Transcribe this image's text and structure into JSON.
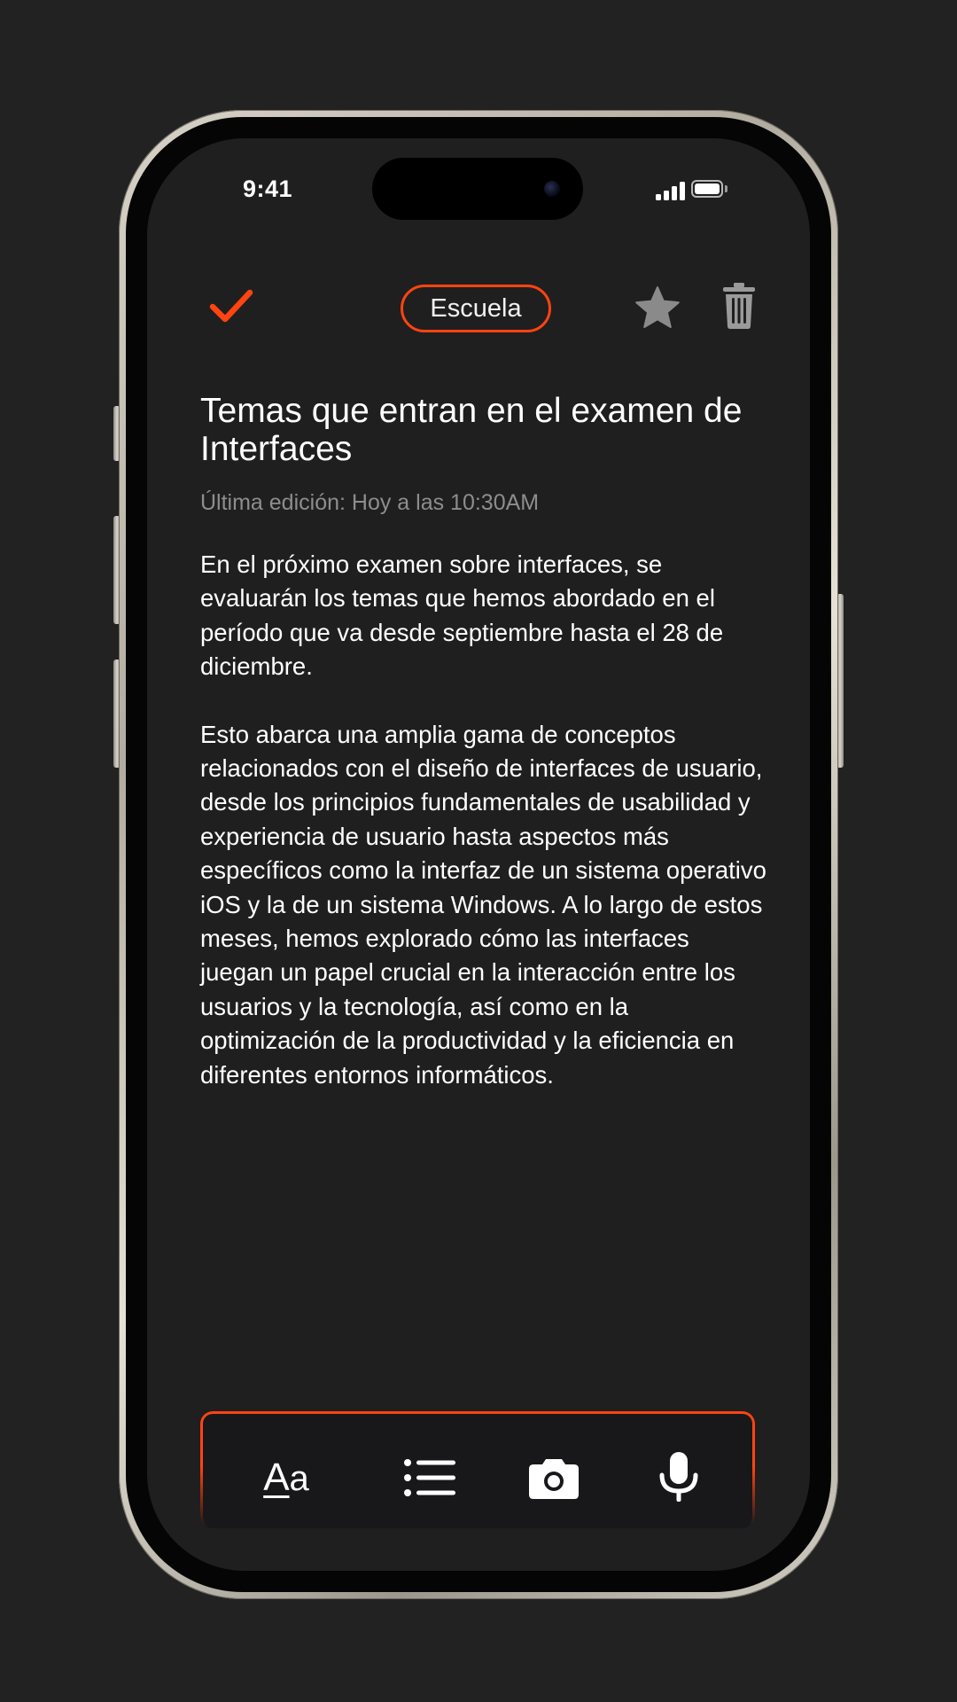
{
  "status_bar": {
    "time": "9:41"
  },
  "toolbar": {
    "tag_label": "Escuela",
    "accent_color": "#ff4411",
    "icons": [
      "checkmark-icon",
      "star-icon",
      "trash-icon"
    ]
  },
  "note": {
    "title": "Temas que entran en el examen de Interfaces",
    "last_edited": "Última edición: Hoy a las 10:30AM",
    "paragraphs": [
      "En el próximo examen sobre interfaces, se evaluarán los temas que hemos abordado en el período que va desde septiembre hasta el 28 de diciembre.",
      "Esto abarca una amplia gama de conceptos relacionados con el diseño de interfaces de usuario, desde los principios fundamentales de usabilidad y experiencia de usuario hasta aspectos más específicos como la interfaz de un sistema operativo iOS y la de un sistema Windows. A lo largo de estos meses, hemos explorado cómo las interfaces juegan un papel crucial en la interacción entre los usuarios y la tecnología, así como en la optimización de la productividad y la eficiencia en diferentes entornos informáticos."
    ]
  },
  "bottom_toolbar": {
    "text_style_big": "A",
    "text_style_small": "a",
    "icons": [
      "text-format-icon",
      "list-icon",
      "camera-icon",
      "microphone-icon"
    ]
  }
}
